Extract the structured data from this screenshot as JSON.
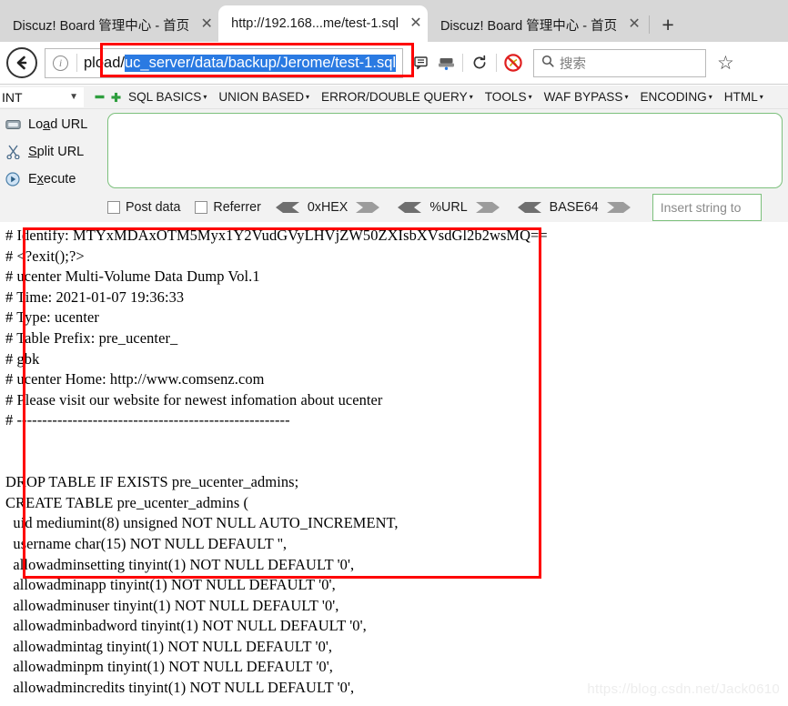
{
  "browser": {
    "tabs": [
      {
        "title": "Discuz! Board 管理中心 - 首页",
        "active": false,
        "close_label": "✕"
      },
      {
        "title": "http://192.168...me/test-1.sql",
        "active": true,
        "close_label": "✕"
      },
      {
        "title": "Discuz! Board 管理中心 - 首页",
        "active": false,
        "close_label": "✕"
      }
    ],
    "new_tab_label": "+",
    "back_icon": "back-arrow-icon",
    "identity_icon_label": "i",
    "url": {
      "prefix": "pload/",
      "selected": "uc_server/data/backup/Jerome/test-1.sql"
    },
    "toolbar_icons": [
      "reader-view-icon",
      "save-to-pocket-icon",
      "reload-icon",
      "blocked-icon"
    ],
    "search": {
      "placeholder": "搜索",
      "icon": "search-icon"
    },
    "bookmark_icon": "star-icon"
  },
  "hackbar": {
    "db_select": {
      "value": "INT",
      "caret": "⌄"
    },
    "minus_label": "−",
    "plus_label": "＋",
    "menus": [
      "SQL BASICS",
      "UNION BASED",
      "ERROR/DOUBLE QUERY",
      "TOOLS",
      "WAF BYPASS",
      "ENCODING",
      "HTML"
    ],
    "actions": [
      {
        "icon": "load-url-icon",
        "pre": "Lo",
        "accel": "a",
        "post": "d URL"
      },
      {
        "icon": "split-url-icon",
        "pre": "",
        "accel": "S",
        "post": "plit URL"
      },
      {
        "icon": "execute-icon",
        "pre": "E",
        "accel": "x",
        "post": "ecute"
      }
    ],
    "textarea_value": "",
    "checkboxes": [
      {
        "label": "Post data",
        "checked": false
      },
      {
        "label": "Referrer",
        "checked": false
      }
    ],
    "encoders": [
      "0xHEX",
      "%URL",
      "BASE64"
    ],
    "insert_placeholder": "Insert string to"
  },
  "content": {
    "dump_text": "# Identify: MTYxMDAxOTM5Myx1Y2VudGVyLHVjZW50ZXIsbXVsdGl2b2wsMQ==\n# <?exit();?>\n# ucenter Multi-Volume Data Dump Vol.1\n# Time: 2021-01-07 19:36:33\n# Type: ucenter\n# Table Prefix: pre_ucenter_\n# gbk\n# ucenter Home: http://www.comsenz.com\n# Please visit our website for newest infomation about ucenter\n# ------------------------------------------------------\n\n\nDROP TABLE IF EXISTS pre_ucenter_admins;\nCREATE TABLE pre_ucenter_admins (\n  uid mediumint(8) unsigned NOT NULL AUTO_INCREMENT,\n  username char(15) NOT NULL DEFAULT '',\n  allowadminsetting tinyint(1) NOT NULL DEFAULT '0',\n  allowadminapp tinyint(1) NOT NULL DEFAULT '0',\n  allowadminuser tinyint(1) NOT NULL DEFAULT '0',\n  allowadminbadword tinyint(1) NOT NULL DEFAULT '0',\n  allowadmintag tinyint(1) NOT NULL DEFAULT '0',\n  allowadminpm tinyint(1) NOT NULL DEFAULT '0',\n  allowadmincredits tinyint(1) NOT NULL DEFAULT '0',"
  },
  "annotations": {
    "url_highlight": "red-rectangle",
    "dump_highlight": "red-rectangle"
  },
  "watermark": {
    "text": "https://blog.csdn.net/Jack0610"
  },
  "colors": {
    "accent_red": "#fe0000",
    "selection_blue": "#2a7ae2",
    "hackbar_green": "#7cc07c",
    "tabstrip_gray": "#d7d7d7"
  }
}
